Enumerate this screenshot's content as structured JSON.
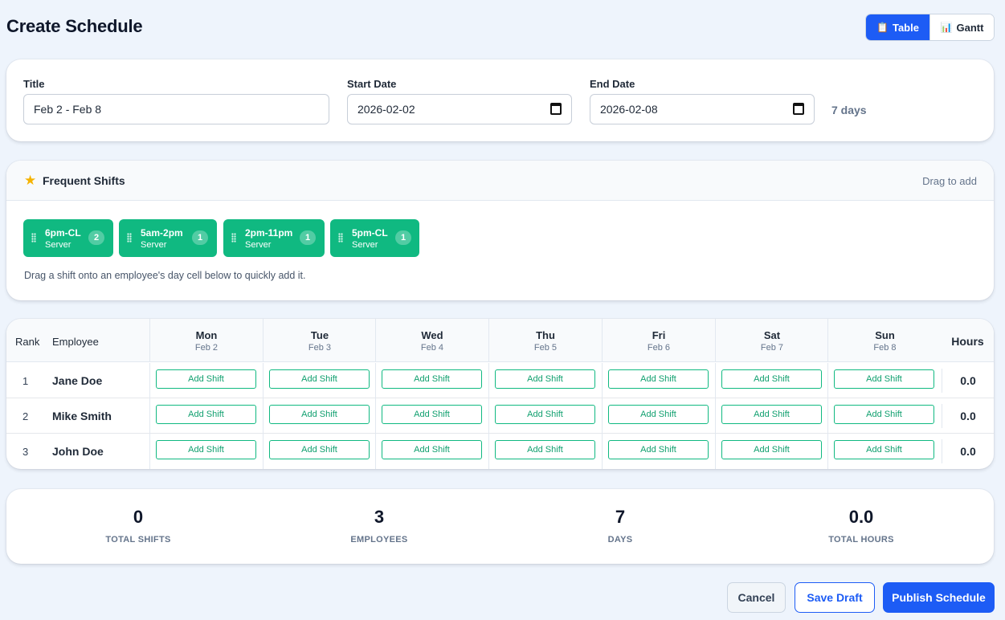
{
  "header": {
    "title": "Create Schedule"
  },
  "view_toggle": {
    "options": [
      {
        "label": "Table",
        "icon": "clipboard-icon",
        "active": true
      },
      {
        "label": "Gantt",
        "icon": "bar-chart-icon",
        "active": false
      }
    ]
  },
  "form": {
    "title_label": "Title",
    "title_value": "Feb 2 - Feb 8",
    "start_label": "Start Date",
    "start_value": "2026-02-02",
    "end_label": "End Date",
    "end_value": "2026-02-08",
    "duration": "7 days"
  },
  "frequent_shifts": {
    "title": "Frequent Shifts",
    "hint": "Drag to add",
    "chips": [
      {
        "time": "6pm-CL",
        "role": "Server",
        "count": "2"
      },
      {
        "time": "5am-2pm",
        "role": "Server",
        "count": "1"
      },
      {
        "time": "2pm-11pm",
        "role": "Server",
        "count": "1"
      },
      {
        "time": "5pm-CL",
        "role": "Server",
        "count": "1"
      }
    ],
    "note": "Drag a shift onto an employee's day cell below to quickly add it."
  },
  "table": {
    "rank_header": "Rank",
    "employee_header": "Employee",
    "hours_header": "Hours",
    "days": [
      {
        "name": "Mon",
        "date": "Feb 2"
      },
      {
        "name": "Tue",
        "date": "Feb 3"
      },
      {
        "name": "Wed",
        "date": "Feb 4"
      },
      {
        "name": "Thu",
        "date": "Feb 5"
      },
      {
        "name": "Fri",
        "date": "Feb 6"
      },
      {
        "name": "Sat",
        "date": "Feb 7"
      },
      {
        "name": "Sun",
        "date": "Feb 8"
      }
    ],
    "add_shift_label": "Add Shift",
    "rows": [
      {
        "rank": "1",
        "employee": "Jane Doe",
        "hours": "0.0"
      },
      {
        "rank": "2",
        "employee": "Mike Smith",
        "hours": "0.0"
      },
      {
        "rank": "3",
        "employee": "John Doe",
        "hours": "0.0"
      }
    ]
  },
  "stats": [
    {
      "value": "0",
      "label": "TOTAL SHIFTS"
    },
    {
      "value": "3",
      "label": "EMPLOYEES"
    },
    {
      "value": "7",
      "label": "DAYS"
    },
    {
      "value": "0.0",
      "label": "TOTAL HOURS"
    }
  ],
  "footer": {
    "cancel_label": "Cancel",
    "save_draft_label": "Save Draft",
    "publish_label": "Publish Schedule"
  },
  "colors": {
    "primary": "#1d5cf5",
    "shift_chip": "#10b981",
    "background": "#eef4fc"
  }
}
